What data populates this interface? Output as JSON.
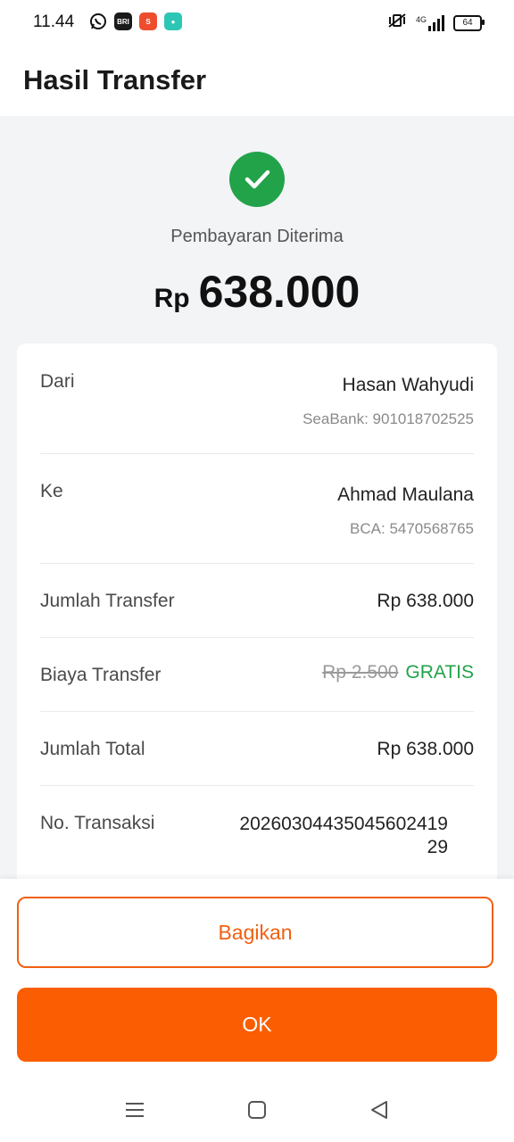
{
  "status_bar": {
    "time": "11.44",
    "battery": "64",
    "network": "4G",
    "app_icons": [
      "whatsapp-icon",
      "bri-mo-icon",
      "shopee-icon",
      "chat-bubble-icon"
    ]
  },
  "header": {
    "title": "Hasil Transfer"
  },
  "result": {
    "status": "Pembayaran Diterima",
    "currency": "Rp",
    "amount": "638.000",
    "success_color": "#22a34a"
  },
  "details": {
    "from": {
      "label": "Dari",
      "name": "Hasan Wahyudi",
      "account": "SeaBank: 901018702525"
    },
    "to": {
      "label": "Ke",
      "name": "Ahmad Maulana",
      "account": "BCA: 5470568765"
    },
    "transfer_amount": {
      "label": "Jumlah Transfer",
      "value": "Rp 638.000"
    },
    "fee": {
      "label": "Biaya Transfer",
      "original": "Rp 2.500",
      "value": "GRATIS"
    },
    "total": {
      "label": "Jumlah Total",
      "value": "Rp 638.000"
    },
    "transaction_no": {
      "label": "No. Transaksi",
      "value_line1": "20260304435045602419",
      "value_line2": "29"
    }
  },
  "actions": {
    "share_label": "Bagikan",
    "ok_label": "OK",
    "accent": "#fb5e02"
  }
}
